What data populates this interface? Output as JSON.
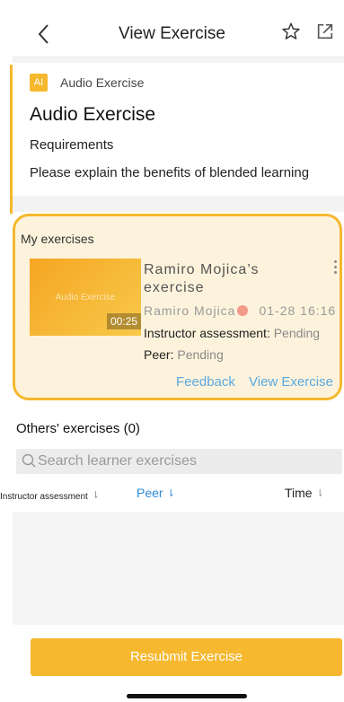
{
  "header": {
    "title": "View Exercise",
    "back_icon": "chevron-left-icon",
    "favorite_icon": "star-outline-icon",
    "share_icon": "external-link-icon"
  },
  "exercise": {
    "badge": "AI",
    "type": "Audio Exercise",
    "title": "Audio Exercise",
    "requirements_label": "Requirements",
    "requirements_text": "Please explain the benefits of blended learning"
  },
  "my_exercises": {
    "heading": "My exercises",
    "item": {
      "thumbnail_label": "Audio Exercise",
      "duration": "00:25",
      "name": "Ramiro Mojica’s exercise",
      "author": "Ramiro Mojica",
      "date": "01-28 16:16",
      "instructor_label": "Instructor assessment:",
      "instructor_status": "Pending",
      "peer_label": "Peer:",
      "peer_status": "Pending",
      "feedback_link": "Feedback",
      "view_link": "View Exercise"
    }
  },
  "others": {
    "heading": "Others' exercises (0)",
    "search_placeholder": "Search learner exercises",
    "sort_options": [
      {
        "label": "Instructor assessment",
        "active": false
      },
      {
        "label": "Peer",
        "active": true
      },
      {
        "label": "Time",
        "active": false
      }
    ]
  },
  "actions": {
    "resubmit": "Resubmit Exercise"
  },
  "colors": {
    "accent": "#F5B82E",
    "link": "#5AA9E0",
    "active_sort": "#2E8BD8"
  }
}
